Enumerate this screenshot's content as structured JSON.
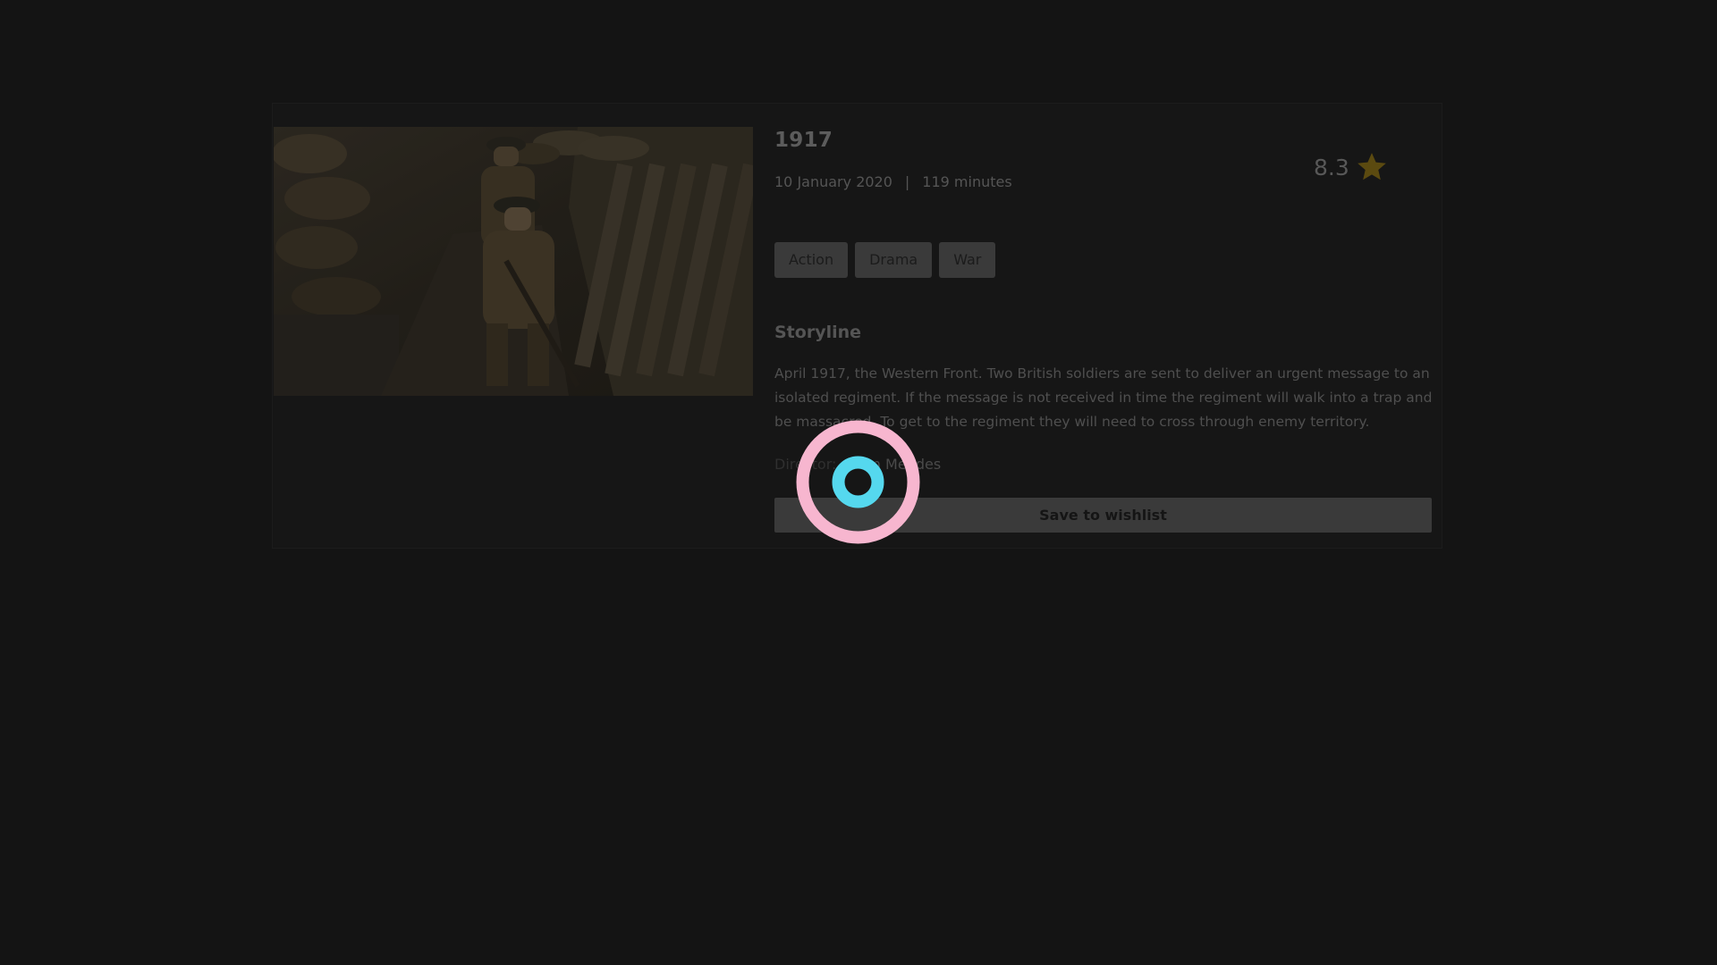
{
  "movie": {
    "title": "1917",
    "release_date": "10 January 2020",
    "separator": "|",
    "runtime": "119 minutes",
    "rating": "8.3",
    "genres": [
      "Action",
      "Drama",
      "War"
    ],
    "storyline_heading": "Storyline",
    "storyline": "April 1917, the Western Front. Two British soldiers are sent to deliver an urgent message to an isolated regiment. If the message is not received in time the regiment will walk into a trap and be massacred. To get to the regiment they will need to cross through enemy territory.",
    "director_label": "Director:",
    "director_name": "Sam Mendes"
  },
  "actions": {
    "wishlist_label": "Save to wishlist"
  },
  "icons": {
    "rating": "star-icon",
    "click_indicator": "click-target-icon"
  },
  "colors": {
    "background": "#141414",
    "star": "#5b4a10",
    "marker_outer": "#f7b6cf",
    "marker_inner": "#55d8ee"
  }
}
